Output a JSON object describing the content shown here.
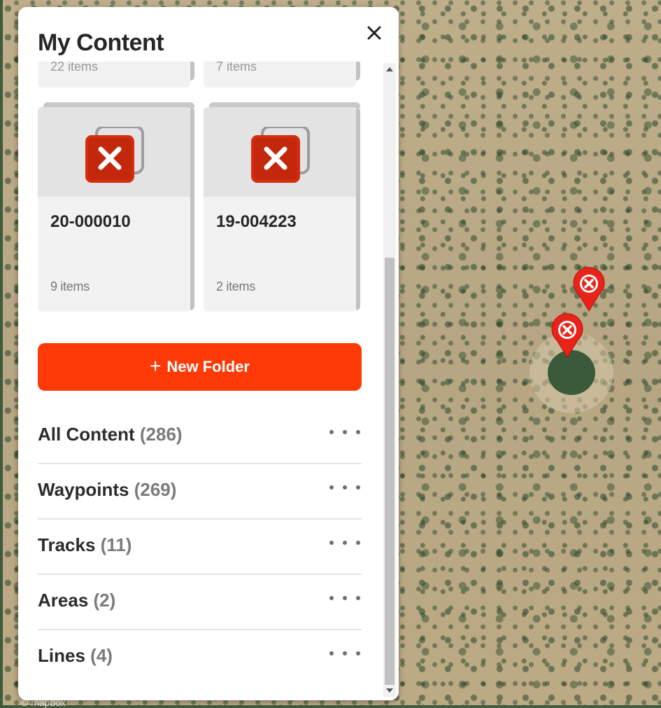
{
  "panel": {
    "title": "My Content",
    "close_icon": "close-icon"
  },
  "folders_partial": [
    {
      "count_label": "22 items"
    },
    {
      "count_label": "7 items"
    }
  ],
  "folders": [
    {
      "name": "20-000010",
      "count_label": "9 items",
      "thumbnail_icon": "delete-marker-icon"
    },
    {
      "name": "19-004223",
      "count_label": "2 items",
      "thumbnail_icon": "delete-marker-icon"
    }
  ],
  "new_folder": {
    "plus": "+",
    "label": "New Folder"
  },
  "content_rows": [
    {
      "label": "All Content",
      "count": "(286)"
    },
    {
      "label": "Waypoints",
      "count": "(269)"
    },
    {
      "label": "Tracks",
      "count": "(11)"
    },
    {
      "label": "Areas",
      "count": "(2)"
    },
    {
      "label": "Lines",
      "count": "(4)"
    }
  ],
  "map": {
    "attribution": "© mapbox",
    "markers": [
      {
        "icon": "delete-marker-icon"
      },
      {
        "icon": "delete-marker-icon"
      }
    ]
  },
  "colors": {
    "accent": "#ff3a06",
    "marker": "#e8231a",
    "thumb_red": "#d42d10"
  }
}
